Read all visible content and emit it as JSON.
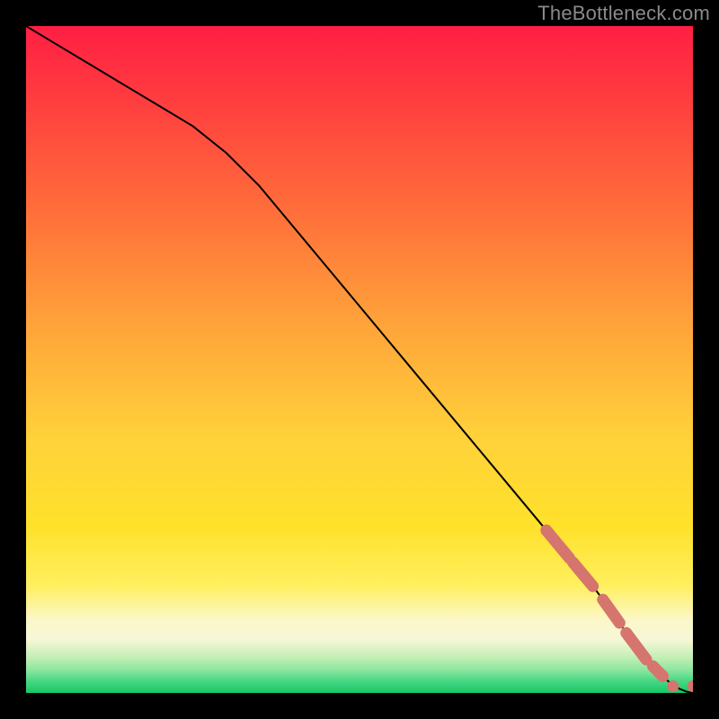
{
  "watermark": "TheBottleneck.com",
  "colors": {
    "frame": "#000000",
    "line": "#000000",
    "marker": "#d6746e",
    "grad_top": "#ff1f44",
    "grad_mid": "#ffe12a",
    "grad_lightband": "#fbf7c9",
    "grad_green_top": "#7fe28f",
    "grad_green_bottom": "#16c765"
  },
  "chart_data": {
    "type": "line",
    "title": "",
    "xlabel": "",
    "ylabel": "",
    "xlim": [
      0,
      100
    ],
    "ylim": [
      0,
      100
    ],
    "series": [
      {
        "name": "bottleneck-curve",
        "x": [
          0,
          5,
          10,
          15,
          20,
          25,
          30,
          35,
          40,
          45,
          50,
          55,
          60,
          65,
          70,
          75,
          80,
          85,
          88,
          90,
          92,
          94,
          95,
          96,
          97,
          98,
          99,
          100
        ],
        "y": [
          100,
          97,
          94,
          91,
          88,
          85,
          81,
          76,
          70,
          64,
          58,
          52,
          46,
          40,
          34,
          28,
          22,
          16,
          12,
          9,
          6,
          4,
          3,
          2,
          1.2,
          0.6,
          0.2,
          0
        ]
      }
    ],
    "markers": [
      {
        "name": "cluster-a",
        "x_range": [
          78,
          81.5
        ],
        "y_range": [
          24,
          20
        ]
      },
      {
        "name": "cluster-b",
        "x_range": [
          82,
          85
        ],
        "y_range": [
          19,
          15
        ]
      },
      {
        "name": "cluster-c",
        "x_range": [
          86.5,
          89
        ],
        "y_range": [
          13,
          10
        ]
      },
      {
        "name": "cluster-d",
        "x_range": [
          90,
          93
        ],
        "y_range": [
          9,
          5
        ]
      },
      {
        "name": "cluster-e",
        "x_range": [
          94,
          95.5
        ],
        "y_range": [
          4,
          2.5
        ]
      },
      {
        "name": "point-f",
        "x": 97,
        "y": 1
      },
      {
        "name": "point-g",
        "x": 100,
        "y": 1
      }
    ]
  }
}
